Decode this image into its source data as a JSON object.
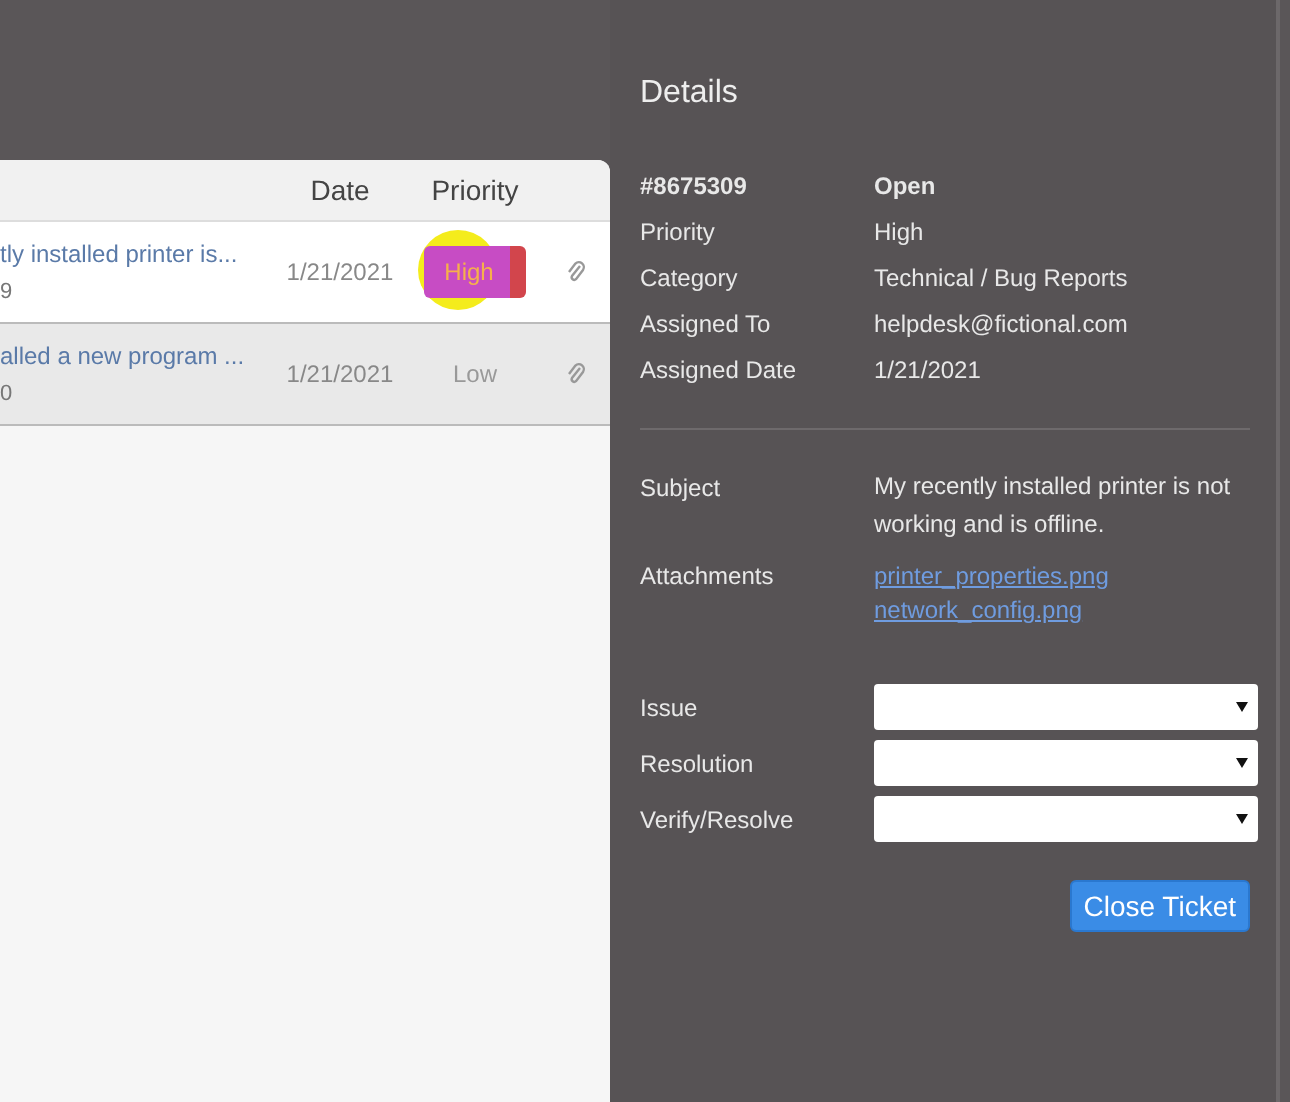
{
  "table": {
    "columns": [
      "Date",
      "Priority"
    ],
    "rows": [
      {
        "subject": "tly installed printer is...",
        "number": "9",
        "date": "1/21/2021",
        "priority": {
          "text": "High",
          "kind": "badge"
        },
        "selected": true
      },
      {
        "subject": "alled a new program ...",
        "number": "0",
        "date": "1/21/2021",
        "priority": {
          "text": "Low",
          "kind": "plain"
        },
        "selected": false
      }
    ]
  },
  "details": {
    "title": "Details",
    "header": {
      "id": "#8675309",
      "status": "Open"
    },
    "fields": [
      {
        "label": "Priority",
        "value": "High"
      },
      {
        "label": "Category",
        "value": "Technical / Bug Reports"
      },
      {
        "label": "Assigned To",
        "value": "helpdesk@fictional.com"
      },
      {
        "label": "Assigned Date",
        "value": "1/21/2021"
      }
    ],
    "subject": {
      "label": "Subject",
      "value": "My recently installed printer is not working and is offline."
    },
    "attachments": {
      "label": "Attachments",
      "links": [
        "printer_properties.png",
        "network_config.png"
      ]
    },
    "selects": [
      {
        "label": "Issue"
      },
      {
        "label": "Resolution"
      },
      {
        "label": "Verify/Resolve"
      }
    ],
    "button": "Close Ticket"
  }
}
